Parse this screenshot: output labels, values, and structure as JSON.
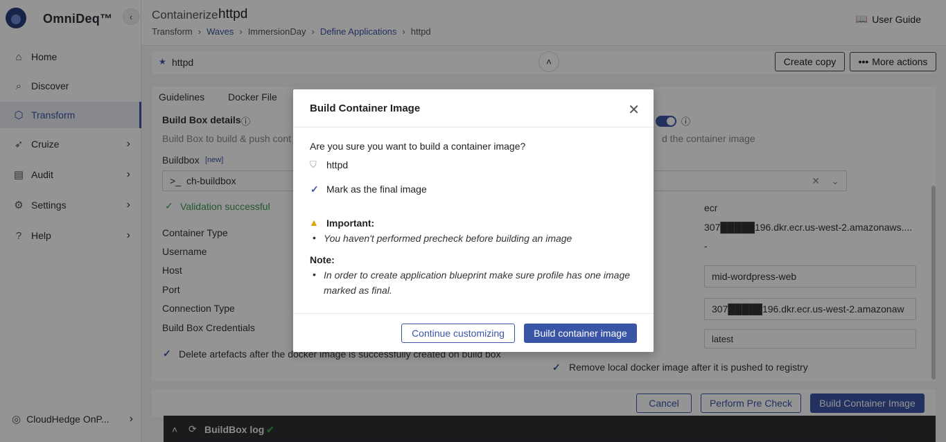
{
  "sidebar": {
    "brand": "OmniDeq™",
    "items": [
      {
        "label": "Home",
        "icon": "home-icon",
        "glyph": "⌂"
      },
      {
        "label": "Discover",
        "icon": "discover-icon",
        "glyph": "⌕"
      },
      {
        "label": "Transform",
        "icon": "cube-icon",
        "glyph": "⬡"
      },
      {
        "label": "Cruize",
        "icon": "rocket-icon",
        "glyph": "➶"
      },
      {
        "label": "Audit",
        "icon": "clipboard-icon",
        "glyph": "▤"
      },
      {
        "label": "Settings",
        "icon": "gear-icon",
        "glyph": "⚙"
      },
      {
        "label": "Help",
        "icon": "help-icon",
        "glyph": "?"
      }
    ],
    "footer": "CloudHedge OnP..."
  },
  "header": {
    "title_prefix": "Containerize",
    "title": "httpd",
    "breadcrumb": [
      "Transform",
      "Waves",
      "ImmersionDay",
      "Define Applications",
      "httpd"
    ],
    "user_guide": "User Guide"
  },
  "toolbar": {
    "app_name": "httpd",
    "create_copy": "Create copy",
    "more_actions": "More actions"
  },
  "tabs": [
    "Guidelines",
    "Docker File"
  ],
  "form": {
    "section_title": "Build Box details",
    "section_desc": "Build Box to build & push cont",
    "right_desc": "d the container image",
    "buildbox_label": "Buildbox",
    "buildbox_tag": "[new]",
    "buildbox_value": "ch-buildbox",
    "validation": "Validation successful",
    "fields": [
      "Container Type",
      "Username",
      "Host",
      "Port",
      "Connection Type",
      "Build Box Credentials"
    ],
    "right_values": [
      "ecr",
      "307█████196.dkr.ecr.us-west-2.amazonaws....",
      "-"
    ],
    "repo_name": "mid-wordpress-web",
    "registry": "307█████196.dkr.ecr.us-west-2.amazonaw",
    "tag": "latest",
    "delete_artefacts": "Delete artefacts after the docker image is successfully created on build box",
    "remove_local": "Remove local docker image after it is pushed to registry"
  },
  "footer": {
    "cancel": "Cancel",
    "precheck": "Perform Pre Check",
    "build": "Build Container Image",
    "buildlog": "BuildBox log"
  },
  "modal": {
    "title": "Build Container Image",
    "question": "Are you sure you want to build a container image?",
    "image_name": "httpd",
    "mark_final": "Mark as the final image",
    "important_label": "Important:",
    "important_item": "You haven't performed precheck before building an image",
    "note_label": "Note:",
    "note_item_1": "In order to create application blueprint make sure profile has one image",
    "note_item_2": "marked as final.",
    "continue": "Continue customizing",
    "build": "Build container image"
  },
  "colors": {
    "accent": "#3b55a6",
    "success": "#3a9a4b",
    "warning": "#e0a100"
  }
}
